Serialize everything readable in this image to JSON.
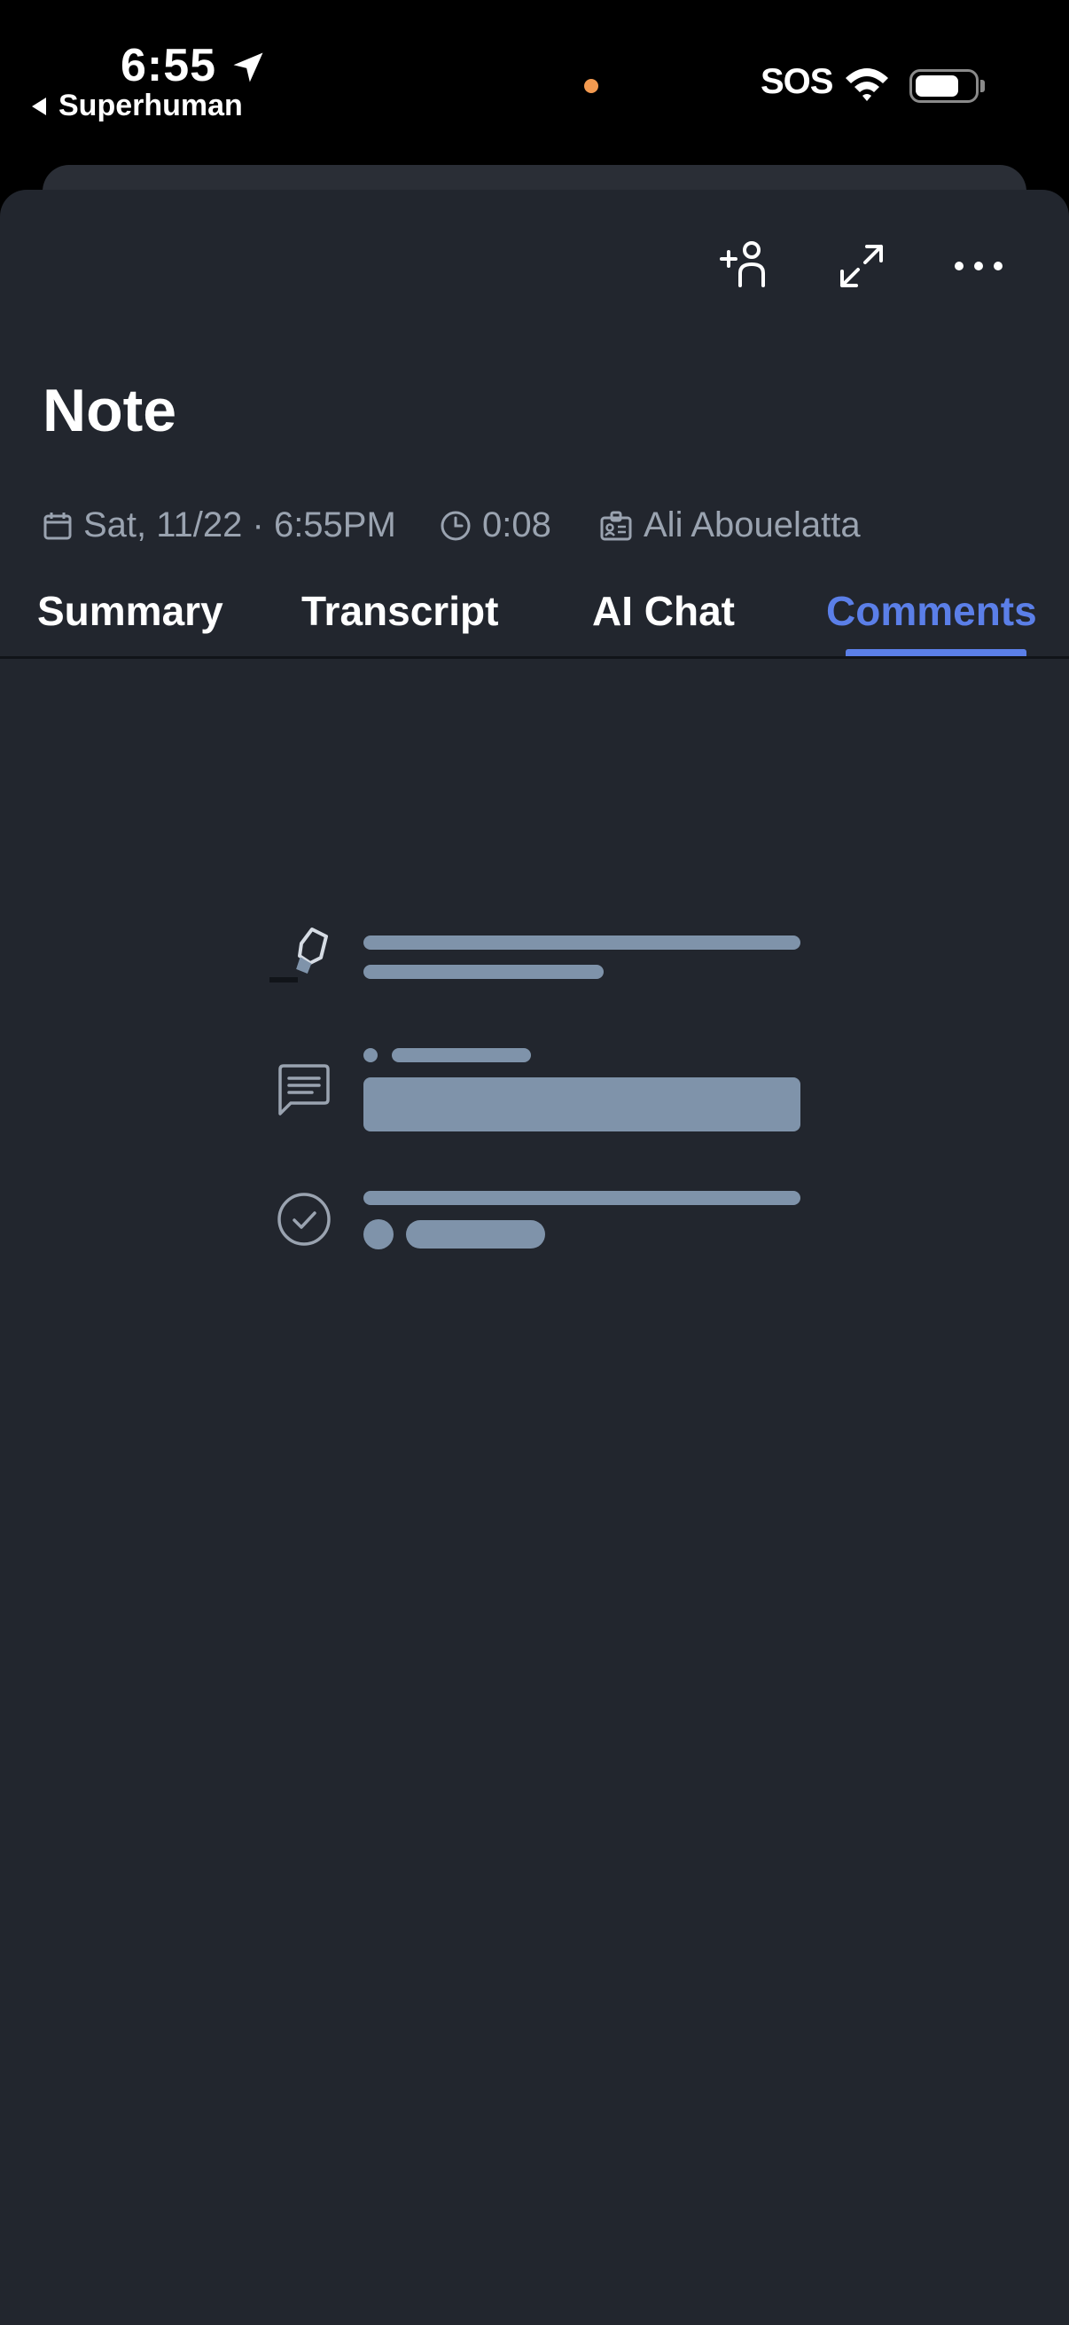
{
  "status_bar": {
    "time": "6:55",
    "back_app": "Superhuman",
    "sos": "SOS",
    "battery_level": 0.75
  },
  "note": {
    "title": "Note",
    "date": "Sat, 11/22 · 6:55PM",
    "duration": "0:08",
    "owner": "Ali Abouelatta"
  },
  "toolbar": {
    "icons": [
      "add-person-icon",
      "expand-icon",
      "more-icon"
    ]
  },
  "tabs": [
    {
      "label": "Summary",
      "active": false
    },
    {
      "label": "Transcript",
      "active": false
    },
    {
      "label": "AI Chat",
      "active": false
    },
    {
      "label": "Comments",
      "active": true
    }
  ],
  "colors": {
    "background": "#22262E",
    "accent": "#5B7FE8",
    "muted_text": "#9AA3B0",
    "placeholder": "#7F93AA"
  },
  "empty_state": {
    "icons": [
      "highlighter-icon",
      "comment-icon",
      "check-circle-icon"
    ]
  }
}
